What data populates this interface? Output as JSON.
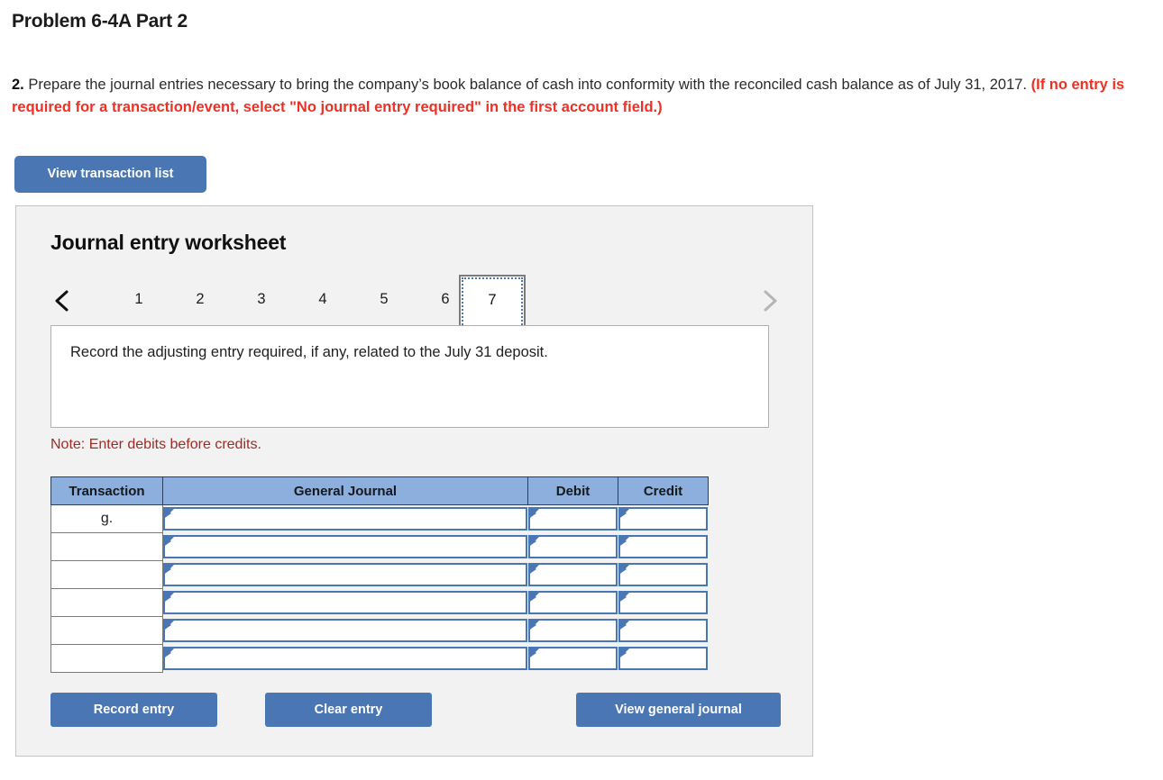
{
  "problem": {
    "title": "Problem 6-4A Part 2"
  },
  "instructions": {
    "number": "2.",
    "body": " Prepare the journal entries necessary to bring the company’s book balance of cash into conformity with the reconciled cash balance as of July 31, 2017. ",
    "red_note": "(If no entry is required for a transaction/event, select \"No journal entry required\" in the first account field.)"
  },
  "toolbar": {
    "view_transaction_list_label": "View transaction list"
  },
  "worksheet": {
    "heading": "Journal entry worksheet",
    "tabs": [
      "1",
      "2",
      "3",
      "4",
      "5",
      "6",
      "7"
    ],
    "selected_tab": "7",
    "prev_icon": "chevron-left-icon",
    "next_icon": "chevron-right-icon",
    "question": "Record the adjusting entry required, if any, related to the July 31 deposit.",
    "note": "Note: Enter debits before credits."
  },
  "table": {
    "headers": [
      "Transaction",
      "General Journal",
      "Debit",
      "Credit"
    ],
    "rows": [
      {
        "transaction": "g.",
        "general_journal": "",
        "debit": "",
        "credit": ""
      },
      {
        "transaction": "",
        "general_journal": "",
        "debit": "",
        "credit": ""
      },
      {
        "transaction": "",
        "general_journal": "",
        "debit": "",
        "credit": ""
      },
      {
        "transaction": "",
        "general_journal": "",
        "debit": "",
        "credit": ""
      },
      {
        "transaction": "",
        "general_journal": "",
        "debit": "",
        "credit": ""
      },
      {
        "transaction": "",
        "general_journal": "",
        "debit": "",
        "credit": ""
      }
    ]
  },
  "footer": {
    "record_entry_label": "Record entry",
    "clear_entry_label": "Clear entry",
    "view_general_journal_label": "View general journal"
  },
  "colors": {
    "button_blue": "#4a77b4",
    "table_header_blue": "#8cafde",
    "panel_gray": "#f2f2f2",
    "note_red": "#9b2c26",
    "instruction_red": "#ee3124"
  }
}
